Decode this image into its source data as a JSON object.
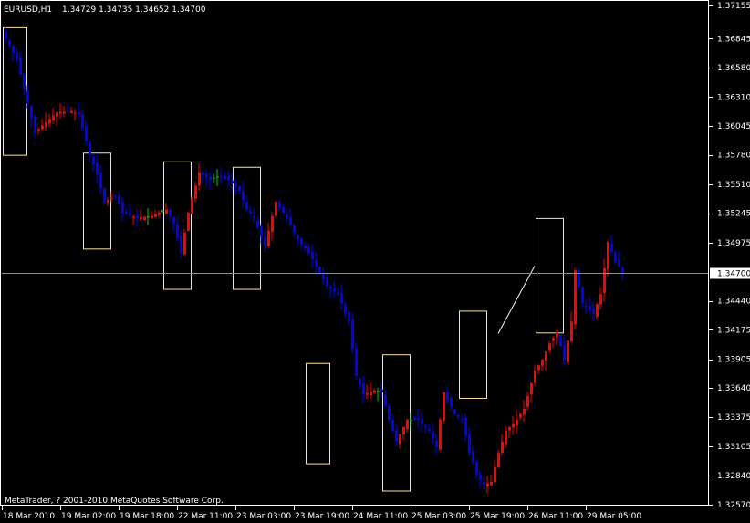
{
  "header": {
    "symbol_label": "EURUSD,H1",
    "ohlc_text": "1.34729 1.34735 1.34652 1.34700"
  },
  "footer": {
    "copyright": "MetaTrader, ? 2001-2010 MetaQuotes Software Corp."
  },
  "current_price": {
    "value": 1.347,
    "label": "1.34700"
  },
  "colors": {
    "background": "#000000",
    "bull_candle": "#ff0000",
    "bear_candle": "#0000ff",
    "doji": "#00cc00",
    "frame": "#ffffff",
    "box_outline": "#ffe0a0",
    "price_line": "#8c8ca0",
    "trend_line": "#ffffff",
    "text": "#ffffff"
  },
  "chart_data": {
    "type": "candlestick",
    "timeframe": "H1",
    "symbol": "EURUSD",
    "ylim": [
      1.3257,
      1.3715
    ],
    "y_ticks": [
      {
        "value": 1.3715,
        "label": "1.37155"
      },
      {
        "value": 1.36845,
        "label": "1.36845"
      },
      {
        "value": 1.3658,
        "label": "1.36580"
      },
      {
        "value": 1.3631,
        "label": "1.36310"
      },
      {
        "value": 1.36045,
        "label": "1.36045"
      },
      {
        "value": 1.3578,
        "label": "1.35780"
      },
      {
        "value": 1.3551,
        "label": "1.35510"
      },
      {
        "value": 1.35245,
        "label": "1.35245"
      },
      {
        "value": 1.34975,
        "label": "1.34975"
      },
      {
        "value": 1.3444,
        "label": "1.34440"
      },
      {
        "value": 1.34175,
        "label": "1.34175"
      },
      {
        "value": 1.33905,
        "label": "1.33905"
      },
      {
        "value": 1.3364,
        "label": "1.33640"
      },
      {
        "value": 1.33375,
        "label": "1.33375"
      },
      {
        "value": 1.33105,
        "label": "1.33105"
      },
      {
        "value": 1.3284,
        "label": "1.32840"
      },
      {
        "value": 1.3257,
        "label": "1.32570"
      }
    ],
    "x_ticks": [
      {
        "bar": 0,
        "label": "18 Mar 2010"
      },
      {
        "bar": 16,
        "label": "19 Mar 02:00"
      },
      {
        "bar": 32,
        "label": "19 Mar 18:00"
      },
      {
        "bar": 48,
        "label": "22 Mar 11:00"
      },
      {
        "bar": 64,
        "label": "23 Mar 03:00"
      },
      {
        "bar": 80,
        "label": "23 Mar 19:00"
      },
      {
        "bar": 96,
        "label": "24 Mar 11:00"
      },
      {
        "bar": 112,
        "label": "25 Mar 03:00"
      },
      {
        "bar": 128,
        "label": "25 Mar 19:00"
      },
      {
        "bar": 144,
        "label": "26 Mar 11:00"
      },
      {
        "bar": 160,
        "label": "29 Mar 05:00"
      }
    ],
    "anchors": [
      [
        0,
        1.3685
      ],
      [
        3,
        1.3665
      ],
      [
        6,
        1.3625
      ],
      [
        8,
        1.3598
      ],
      [
        10,
        1.3605
      ],
      [
        14,
        1.3617
      ],
      [
        18,
        1.3618
      ],
      [
        20,
        1.3615
      ],
      [
        23,
        1.3578
      ],
      [
        25,
        1.356
      ],
      [
        27,
        1.3535
      ],
      [
        30,
        1.354
      ],
      [
        32,
        1.3525
      ],
      [
        36,
        1.352
      ],
      [
        40,
        1.3522
      ],
      [
        44,
        1.3528
      ],
      [
        46,
        1.3515
      ],
      [
        48,
        1.3488
      ],
      [
        50,
        1.3525
      ],
      [
        53,
        1.3562
      ],
      [
        56,
        1.3555
      ],
      [
        58,
        1.3558
      ],
      [
        61,
        1.3555
      ],
      [
        64,
        1.3545
      ],
      [
        66,
        1.3528
      ],
      [
        68,
        1.352
      ],
      [
        71,
        1.3495
      ],
      [
        74,
        1.3535
      ],
      [
        77,
        1.352
      ],
      [
        80,
        1.35
      ],
      [
        83,
        1.3488
      ],
      [
        86,
        1.347
      ],
      [
        88,
        1.3458
      ],
      [
        91,
        1.345
      ],
      [
        94,
        1.3425
      ],
      [
        96,
        1.3375
      ],
      [
        98,
        1.3358
      ],
      [
        101,
        1.3362
      ],
      [
        103,
        1.336
      ],
      [
        105,
        1.3335
      ],
      [
        107,
        1.3315
      ],
      [
        110,
        1.3335
      ],
      [
        113,
        1.3335
      ],
      [
        116,
        1.3325
      ],
      [
        118,
        1.331
      ],
      [
        120,
        1.336
      ],
      [
        123,
        1.334
      ],
      [
        125,
        1.3335
      ],
      [
        127,
        1.3305
      ],
      [
        129,
        1.3285
      ],
      [
        131,
        1.3275
      ],
      [
        133,
        1.3278
      ],
      [
        135,
        1.3305
      ],
      [
        137,
        1.3325
      ],
      [
        140,
        1.3335
      ],
      [
        142,
        1.3345
      ],
      [
        145,
        1.338
      ],
      [
        147,
        1.339
      ],
      [
        149,
        1.3405
      ],
      [
        151,
        1.3415
      ],
      [
        153,
        1.339
      ],
      [
        155,
        1.3425
      ],
      [
        156,
        1.3472
      ],
      [
        158,
        1.3442
      ],
      [
        161,
        1.3432
      ],
      [
        163,
        1.345
      ],
      [
        165,
        1.3498
      ],
      [
        167,
        1.348
      ],
      [
        169,
        1.347
      ]
    ],
    "rectangles": [
      {
        "bar_from": 0,
        "bar_to": 5,
        "price_high": 1.3695,
        "price_low": 1.3578
      },
      {
        "bar_from": 22,
        "bar_to": 28,
        "price_high": 1.358,
        "price_low": 1.3492
      },
      {
        "bar_from": 44,
        "bar_to": 50,
        "price_high": 1.3572,
        "price_low": 1.3455
      },
      {
        "bar_from": 63,
        "bar_to": 69,
        "price_high": 1.3567,
        "price_low": 1.3455
      },
      {
        "bar_from": 83,
        "bar_to": 88,
        "price_high": 1.3387,
        "price_low": 1.3295
      },
      {
        "bar_from": 104,
        "bar_to": 110,
        "price_high": 1.3395,
        "price_low": 1.327
      },
      {
        "bar_from": 125,
        "bar_to": 131,
        "price_high": 1.3435,
        "price_low": 1.3355
      },
      {
        "bar_from": 146,
        "bar_to": 152,
        "price_high": 1.352,
        "price_low": 1.3415
      }
    ],
    "trend_line": {
      "bar_from": 135,
      "price_from": 1.3414,
      "bar_to": 145,
      "price_to": 1.3476
    }
  }
}
